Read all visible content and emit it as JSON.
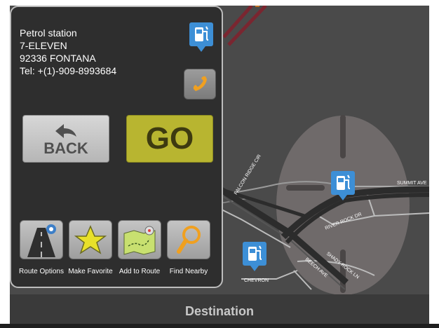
{
  "poi": {
    "category": "Petrol station",
    "name": "7-ELEVEN",
    "postal_city": "92336 FONTANA",
    "phone": "Tel: +(1)-909-8993684",
    "icon": "fuel-pump-icon"
  },
  "buttons": {
    "back_label": "BACK",
    "go_label": "GO"
  },
  "actions": [
    {
      "label": "Route Options",
      "icon": "route-options-icon"
    },
    {
      "label": "Make Favorite",
      "icon": "star-icon"
    },
    {
      "label": "Add to Route",
      "icon": "map-route-icon"
    },
    {
      "label": "Find Nearby",
      "icon": "magnifier-icon"
    }
  ],
  "map": {
    "streets": [
      "FALCON RIDGE CIR",
      "SUMMIT AVE",
      "RIVER ROCK DR",
      "SHADY ROCK LN",
      "BEECH AVE",
      "CHEVRON"
    ]
  },
  "footer": {
    "title": "Destination"
  },
  "colors": {
    "go_button": "#b8b530",
    "poi_badge": "#3d8fd6",
    "phone_icon": "#f0a020"
  }
}
